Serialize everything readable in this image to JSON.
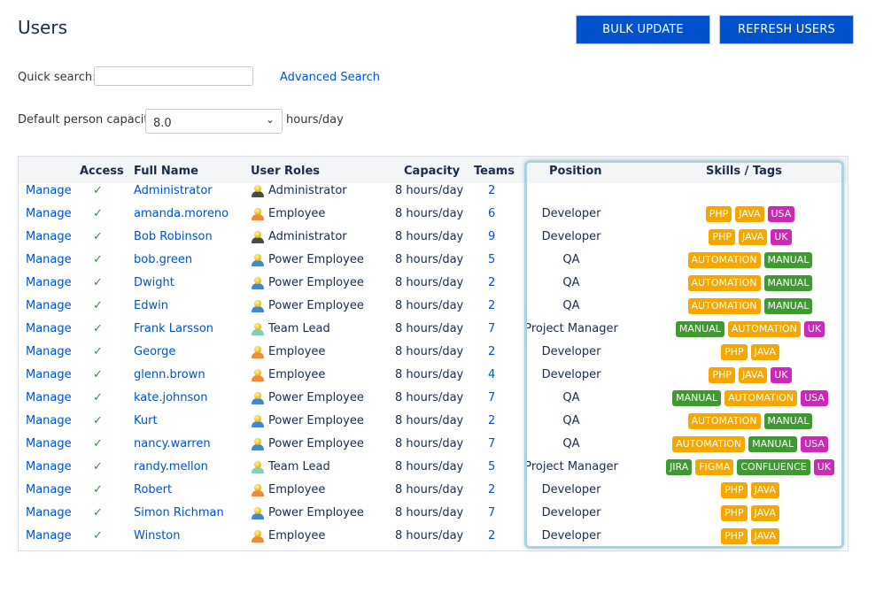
{
  "page": {
    "title": "Users"
  },
  "toolbar": {
    "bulk_update_label": "BULK UPDATE",
    "refresh_users_label": "REFRESH USERS"
  },
  "search": {
    "label": "Quick search:",
    "value": "",
    "placeholder": "",
    "advanced_link": "Advanced Search"
  },
  "capacity": {
    "label": "Default person capacity:",
    "selected": "8.0",
    "unit": "hours/day"
  },
  "colors": {
    "primary": "#0052cc",
    "tag_orange": "#f5a700",
    "tag_green": "#3d9a2f",
    "tag_magenta": "#cc29b8",
    "highlight_border": "#a9d3df",
    "check": "#1f9d1f"
  },
  "table": {
    "headers": {
      "manage": "",
      "access": "Access",
      "full_name": "Full Name",
      "user_roles": "User Roles",
      "capacity": "Capacity",
      "teams": "Teams",
      "position": "Position",
      "skills": "Skills / Tags"
    },
    "rows": [
      {
        "manage": "Manage",
        "access": "✓",
        "name": "Administrator",
        "role": "Administrator",
        "role_icon": "admin-user-icon",
        "capacity": "8 hours/day",
        "teams": "2",
        "position": "",
        "tags": []
      },
      {
        "manage": "Manage",
        "access": "✓",
        "name": "amanda.moreno",
        "role": "Employee",
        "role_icon": "employee-user-icon",
        "capacity": "8 hours/day",
        "teams": "6",
        "position": "Developer",
        "tags": [
          {
            "label": "PHP",
            "color": "orange"
          },
          {
            "label": "JAVA",
            "color": "orange"
          },
          {
            "label": "USA",
            "color": "magenta"
          }
        ]
      },
      {
        "manage": "Manage",
        "access": "✓",
        "name": "Bob Robinson",
        "role": "Administrator",
        "role_icon": "admin-user-icon",
        "capacity": "8 hours/day",
        "teams": "9",
        "position": "Developer",
        "tags": [
          {
            "label": "PHP",
            "color": "orange"
          },
          {
            "label": "JAVA",
            "color": "orange"
          },
          {
            "label": "UK",
            "color": "magenta"
          }
        ]
      },
      {
        "manage": "Manage",
        "access": "✓",
        "name": "bob.green",
        "role": "Power Employee",
        "role_icon": "power-employee-user-icon",
        "capacity": "8 hours/day",
        "teams": "5",
        "position": "QA",
        "tags": [
          {
            "label": "AUTOMATION",
            "color": "orange"
          },
          {
            "label": "MANUAL",
            "color": "green"
          }
        ]
      },
      {
        "manage": "Manage",
        "access": "✓",
        "name": "Dwight",
        "role": "Power Employee",
        "role_icon": "power-employee-user-icon",
        "capacity": "8 hours/day",
        "teams": "2",
        "position": "QA",
        "tags": [
          {
            "label": "AUTOMATION",
            "color": "orange"
          },
          {
            "label": "MANUAL",
            "color": "green"
          }
        ]
      },
      {
        "manage": "Manage",
        "access": "✓",
        "name": "Edwin",
        "role": "Power Employee",
        "role_icon": "power-employee-user-icon",
        "capacity": "8 hours/day",
        "teams": "2",
        "position": "QA",
        "tags": [
          {
            "label": "AUTOMATION",
            "color": "orange"
          },
          {
            "label": "MANUAL",
            "color": "green"
          }
        ]
      },
      {
        "manage": "Manage",
        "access": "✓",
        "name": "Frank Larsson",
        "role": "Team Lead",
        "role_icon": "team-lead-user-icon",
        "capacity": "8 hours/day",
        "teams": "7",
        "position": "Project Manager",
        "tags": [
          {
            "label": "MANUAL",
            "color": "green"
          },
          {
            "label": "AUTOMATION",
            "color": "orange"
          },
          {
            "label": "UK",
            "color": "magenta"
          }
        ]
      },
      {
        "manage": "Manage",
        "access": "✓",
        "name": "George",
        "role": "Employee",
        "role_icon": "employee-user-icon",
        "capacity": "8 hours/day",
        "teams": "2",
        "position": "Developer",
        "tags": [
          {
            "label": "PHP",
            "color": "orange"
          },
          {
            "label": "JAVA",
            "color": "orange"
          }
        ]
      },
      {
        "manage": "Manage",
        "access": "✓",
        "name": "glenn.brown",
        "role": "Employee",
        "role_icon": "employee-user-icon",
        "capacity": "8 hours/day",
        "teams": "4",
        "position": "Developer",
        "tags": [
          {
            "label": "PHP",
            "color": "orange"
          },
          {
            "label": "JAVA",
            "color": "orange"
          },
          {
            "label": "UK",
            "color": "magenta"
          }
        ]
      },
      {
        "manage": "Manage",
        "access": "✓",
        "name": "kate.johnson",
        "role": "Power Employee",
        "role_icon": "power-employee-user-icon",
        "capacity": "8 hours/day",
        "teams": "7",
        "position": "QA",
        "tags": [
          {
            "label": "MANUAL",
            "color": "green"
          },
          {
            "label": "AUTOMATION",
            "color": "orange"
          },
          {
            "label": "USA",
            "color": "magenta"
          }
        ]
      },
      {
        "manage": "Manage",
        "access": "✓",
        "name": "Kurt",
        "role": "Power Employee",
        "role_icon": "power-employee-user-icon",
        "capacity": "8 hours/day",
        "teams": "2",
        "position": "QA",
        "tags": [
          {
            "label": "AUTOMATION",
            "color": "orange"
          },
          {
            "label": "MANUAL",
            "color": "green"
          }
        ]
      },
      {
        "manage": "Manage",
        "access": "✓",
        "name": "nancy.warren",
        "role": "Power Employee",
        "role_icon": "power-employee-user-icon",
        "capacity": "8 hours/day",
        "teams": "7",
        "position": "QA",
        "tags": [
          {
            "label": "AUTOMATION",
            "color": "orange"
          },
          {
            "label": "MANUAL",
            "color": "green"
          },
          {
            "label": "USA",
            "color": "magenta"
          }
        ]
      },
      {
        "manage": "Manage",
        "access": "✓",
        "name": "randy.mellon",
        "role": "Team Lead",
        "role_icon": "team-lead-user-icon",
        "capacity": "8 hours/day",
        "teams": "5",
        "position": "Project Manager",
        "tags": [
          {
            "label": "JIRA",
            "color": "green"
          },
          {
            "label": "FIGMA",
            "color": "orange"
          },
          {
            "label": "CONFLUENCE",
            "color": "green"
          },
          {
            "label": "UK",
            "color": "magenta"
          }
        ]
      },
      {
        "manage": "Manage",
        "access": "✓",
        "name": "Robert",
        "role": "Employee",
        "role_icon": "employee-user-icon",
        "capacity": "8 hours/day",
        "teams": "2",
        "position": "Developer",
        "tags": [
          {
            "label": "PHP",
            "color": "orange"
          },
          {
            "label": "JAVA",
            "color": "orange"
          }
        ]
      },
      {
        "manage": "Manage",
        "access": "✓",
        "name": "Simon Richman",
        "role": "Power Employee",
        "role_icon": "power-employee-user-icon",
        "capacity": "8 hours/day",
        "teams": "7",
        "position": "Developer",
        "tags": [
          {
            "label": "PHP",
            "color": "orange"
          },
          {
            "label": "JAVA",
            "color": "orange"
          }
        ]
      },
      {
        "manage": "Manage",
        "access": "✓",
        "name": "Winston",
        "role": "Employee",
        "role_icon": "employee-user-icon",
        "capacity": "8 hours/day",
        "teams": "2",
        "position": "Developer",
        "tags": [
          {
            "label": "PHP",
            "color": "orange"
          },
          {
            "label": "JAVA",
            "color": "orange"
          }
        ]
      }
    ]
  }
}
